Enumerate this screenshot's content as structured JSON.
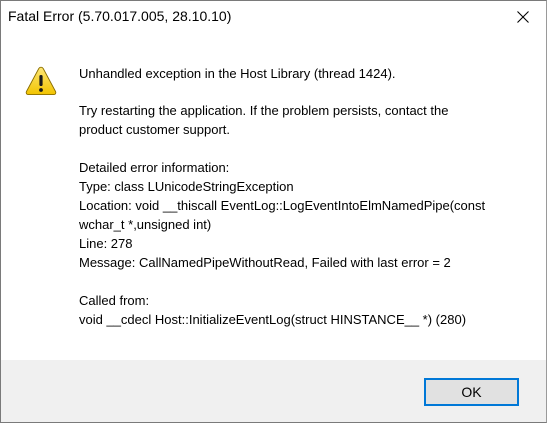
{
  "window": {
    "title": "Fatal Error (5.70.017.005, 28.10.10)"
  },
  "icons": {
    "warning": "warning-icon",
    "close": "close-icon"
  },
  "message": {
    "headline": "Unhandled exception in the Host Library (thread 1424).",
    "restart_line1": "Try restarting the application. If the problem persists, contact the",
    "restart_line2": "product customer support.",
    "details_header": "Detailed error information:",
    "type_line": "Type: class LUnicodeStringException",
    "location_line1": "Location: void __thiscall EventLog::LogEventIntoElmNamedPipe(const",
    "location_line2": "wchar_t *,unsigned int)",
    "line_line": "Line: 278",
    "message_line": "Message: CallNamedPipeWithoutRead, Failed with last error = 2",
    "called_from_header": "Called from:",
    "called_from_line": "void __cdecl Host::InitializeEventLog(struct HINSTANCE__ *) (280)"
  },
  "footer": {
    "ok_label": "OK"
  },
  "colors": {
    "footer_bg": "#f0f0f0",
    "button_focus_border": "#0078d7",
    "warning_yellow": "#f8d21c"
  }
}
